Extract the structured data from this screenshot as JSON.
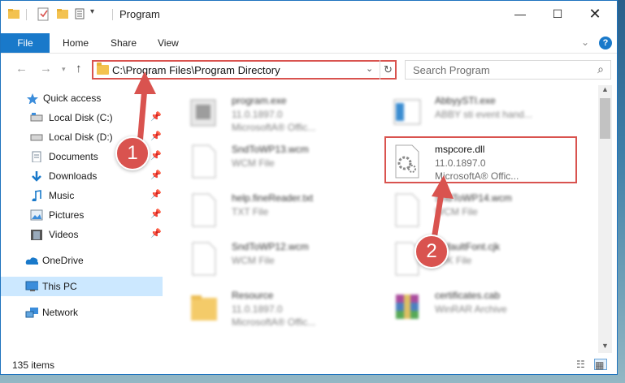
{
  "window": {
    "title": "Program",
    "minimize_icon": "minimize-icon",
    "maximize_icon": "maximize-icon",
    "close_icon": "close-icon"
  },
  "ribbon": {
    "file_label": "File",
    "tabs": [
      "Home",
      "Share",
      "View"
    ]
  },
  "navigation": {
    "address": "C:\\Program Files\\Program Directory",
    "search_placeholder": "Search Program"
  },
  "sidebar": {
    "items": [
      {
        "label": "Quick access",
        "icon": "star-icon"
      },
      {
        "label": "Local Disk (C:)",
        "icon": "drive-icon"
      },
      {
        "label": "Local Disk (D:)",
        "icon": "drive-icon"
      },
      {
        "label": "Documents",
        "icon": "documents-icon"
      },
      {
        "label": "Downloads",
        "icon": "downloads-icon"
      },
      {
        "label": "Music",
        "icon": "music-icon"
      },
      {
        "label": "Pictures",
        "icon": "pictures-icon"
      },
      {
        "label": "Videos",
        "icon": "videos-icon"
      },
      {
        "label": "OneDrive",
        "icon": "onedrive-icon"
      },
      {
        "label": "This PC",
        "icon": "computer-icon"
      },
      {
        "label": "Network",
        "icon": "network-icon"
      }
    ]
  },
  "files": [
    {
      "name": "program.exe",
      "line1": "11.0.1897.0",
      "line2": "MicrosoftA® Offic..."
    },
    {
      "name": "AbbyySTI.exe",
      "line1": "ABBY sti event hand...",
      "line2": ""
    },
    {
      "name": "SndToWP13.wcm",
      "line1": "WCM File",
      "line2": ""
    },
    {
      "name": "mspcore.dll",
      "line1": "11.0.1897.0",
      "line2": "MicrosoftA® Offic..."
    },
    {
      "name": "help.fineReader.txt",
      "line1": "TXT File",
      "line2": ""
    },
    {
      "name": "SndToWP14.wcm",
      "line1": "WCM File",
      "line2": ""
    },
    {
      "name": "SndToWP12.wcm",
      "line1": "WCM File",
      "line2": ""
    },
    {
      "name": "DefaultFont.cjk",
      "line1": "CJK File",
      "line2": ""
    },
    {
      "name": "Resource",
      "line1": "11.0.1897.0",
      "line2": "MicrosoftA® Offic..."
    },
    {
      "name": "certificates.cab",
      "line1": "WinRAR Archive",
      "line2": ""
    }
  ],
  "status": {
    "item_count": "135 items"
  },
  "annotations": {
    "step1": "1",
    "step2": "2",
    "color": "#d9534f"
  },
  "colors": {
    "accent": "#1979ca",
    "selection": "#cce8ff"
  }
}
